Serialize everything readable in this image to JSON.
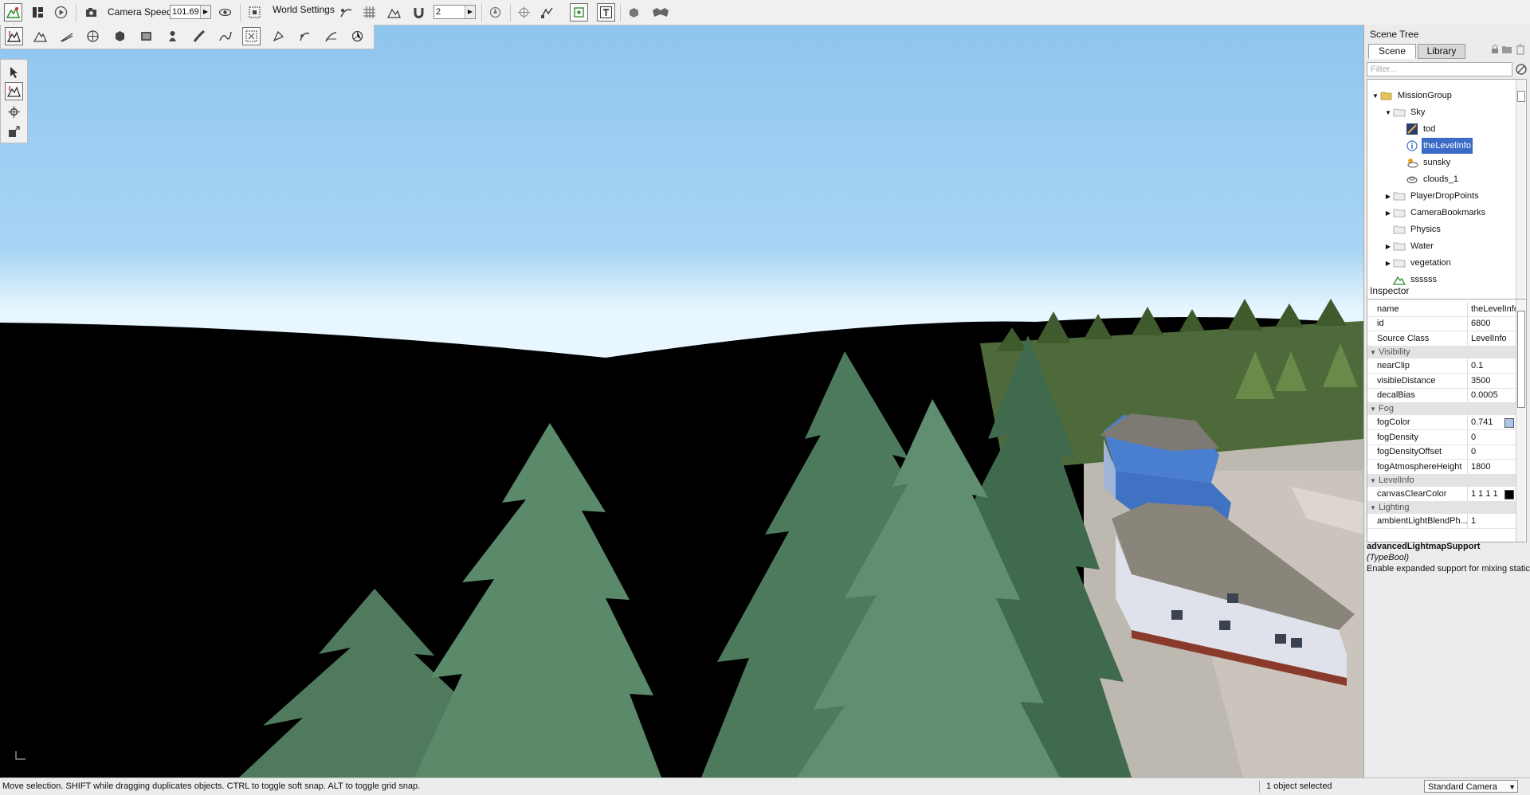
{
  "toolbar": {
    "camera_speed_label": "Camera Speed",
    "camera_speed_value": "101.69",
    "world_settings_label": "World Settings",
    "grid_value": "2",
    "icons": [
      "world-editor-icon",
      "layout-icon",
      "play-icon",
      "camera-icon",
      "visibility-icon",
      "frame-select-icon",
      "snap-curve-icon",
      "grid-snap-icon",
      "terrain-snap-icon",
      "magnet-icon",
      "orientation-icon",
      "pivot-icon",
      "bounds-icon",
      "select-box-icon",
      "text-icon",
      "prefab-icon",
      "gear-cluster-icon"
    ]
  },
  "toolbar2": {
    "icons": [
      "object-editor-icon",
      "terrain-editor-icon",
      "terrain-painter-icon",
      "material-icon",
      "mesh-icon",
      "decal-icon",
      "forest-icon",
      "road-icon",
      "river-icon",
      "nav-mesh-icon",
      "sun-icon",
      "mesh-road-icon",
      "decal-road-icon",
      "gizmo-icon"
    ]
  },
  "palette": {
    "icons": [
      "select-arrow-icon",
      "move-icon",
      "rotate-icon",
      "scale-icon"
    ]
  },
  "status": {
    "message": "Move selection.  SHIFT while dragging duplicates objects.  CTRL to toggle soft snap.  ALT to toggle grid snap.",
    "selection": "1 object selected",
    "camera": "Standard Camera"
  },
  "scene_tree": {
    "title": "Scene Tree",
    "tabs": [
      "Scene",
      "Library"
    ],
    "filter_placeholder": "Filter...",
    "nodes": [
      {
        "label": "MissionGroup",
        "depth": 0,
        "expand": "open",
        "icon": "folder-open-icon"
      },
      {
        "label": "Sky",
        "depth": 1,
        "expand": "open",
        "icon": "folder-icon"
      },
      {
        "label": "tod",
        "depth": 2,
        "expand": "none",
        "icon": "time-of-day-icon"
      },
      {
        "label": "theLevelInfo",
        "depth": 2,
        "expand": "none",
        "icon": "level-info-icon",
        "selected": true
      },
      {
        "label": "sunsky",
        "depth": 2,
        "expand": "none",
        "icon": "sunsky-icon"
      },
      {
        "label": "clouds_1",
        "depth": 2,
        "expand": "none",
        "icon": "clouds-icon"
      },
      {
        "label": "PlayerDropPoints",
        "depth": 1,
        "expand": "closed",
        "icon": "folder-icon"
      },
      {
        "label": "CameraBookmarks",
        "depth": 1,
        "expand": "closed",
        "icon": "folder-icon"
      },
      {
        "label": "Physics",
        "depth": 1,
        "expand": "none",
        "icon": "folder-icon"
      },
      {
        "label": "Water",
        "depth": 1,
        "expand": "closed",
        "icon": "folder-icon"
      },
      {
        "label": "vegetation",
        "depth": 1,
        "expand": "closed",
        "icon": "folder-icon"
      },
      {
        "label": "ssssss",
        "depth": 1,
        "expand": "none",
        "icon": "terrain-icon"
      }
    ]
  },
  "inspector": {
    "title": "Inspector",
    "rows": [
      {
        "type": "prop",
        "name": "name",
        "value": "theLevelInfo"
      },
      {
        "type": "prop",
        "name": "id",
        "value": "6800"
      },
      {
        "type": "prop",
        "name": "Source Class",
        "value": "LevelInfo"
      },
      {
        "type": "group",
        "name": "Visibility"
      },
      {
        "type": "prop",
        "name": "nearClip",
        "value": "0.1"
      },
      {
        "type": "prop",
        "name": "visibleDistance",
        "value": "3500"
      },
      {
        "type": "prop",
        "name": "decalBias",
        "value": "0.0005"
      },
      {
        "type": "group",
        "name": "Fog"
      },
      {
        "type": "prop",
        "name": "fogColor",
        "value": "0.741",
        "swatch": "#a9c6e8"
      },
      {
        "type": "prop",
        "name": "fogDensity",
        "value": "0"
      },
      {
        "type": "prop",
        "name": "fogDensityOffset",
        "value": "0"
      },
      {
        "type": "prop",
        "name": "fogAtmosphereHeight",
        "value": "1800"
      },
      {
        "type": "group",
        "name": "LevelInfo"
      },
      {
        "type": "prop",
        "name": "canvasClearColor",
        "value": "1 1 1 1",
        "swatch": "#000000"
      },
      {
        "type": "group",
        "name": "Lighting"
      },
      {
        "type": "prop",
        "name": "ambientLightBlendPh...",
        "value": "1"
      }
    ],
    "help_title": "advancedLightmapSupport",
    "help_type": "(TypeBool)",
    "help_desc": "Enable expanded support for mixing static"
  },
  "colors": {
    "sky_top": "#8ec5ee",
    "selection": "#3a6bc7",
    "panel_bg": "#ececec"
  }
}
